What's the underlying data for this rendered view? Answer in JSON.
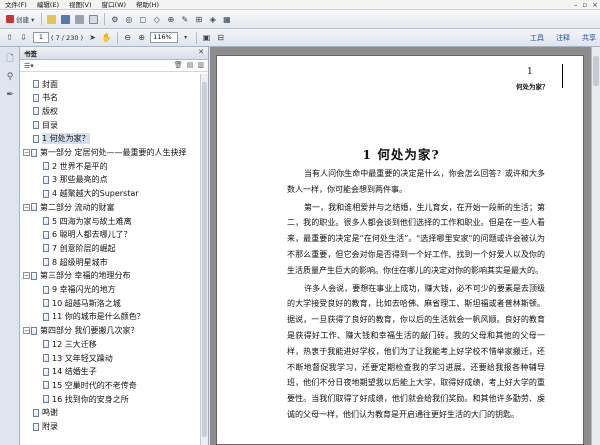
{
  "menu": {
    "items": [
      "文件(F)",
      "编辑(E)",
      "视图(V)",
      "窗口(W)",
      "帮助(H)"
    ]
  },
  "toolbar": {
    "create_label": "创建 ▾",
    "page_current": "1",
    "page_count": "( 7 / 230 )",
    "zoom_value": "116%",
    "links": [
      "工具",
      "注释",
      "共享"
    ]
  },
  "panel": {
    "title": "书签",
    "close": "✕"
  },
  "bookmarks": [
    {
      "label": "封面",
      "level": 0
    },
    {
      "label": "书名",
      "level": 0
    },
    {
      "label": "版权",
      "level": 0
    },
    {
      "label": "目录",
      "level": 0
    },
    {
      "label": "1  何处为家？",
      "level": 0,
      "selected": true
    },
    {
      "label": "第一部分  定居何处——最重要的人生抉择",
      "level": 0,
      "toggle": "−"
    },
    {
      "label": "2  世界不是平的",
      "level": 1
    },
    {
      "label": "3  那些最亮的点",
      "level": 1
    },
    {
      "label": "4  越聚越大的Superstar",
      "level": 1
    },
    {
      "label": "第二部分  流动的财富",
      "level": 0,
      "toggle": "−"
    },
    {
      "label": "5  四海为家与故土难离",
      "level": 1
    },
    {
      "label": "6  聪明人都去哪儿了？",
      "level": 1
    },
    {
      "label": "7  创意阶层的崛起",
      "level": 1
    },
    {
      "label": "8  超级明星城市",
      "level": 1
    },
    {
      "label": "第三部分  幸福的地理分布",
      "level": 0,
      "toggle": "−"
    },
    {
      "label": "9  幸福闪光的地方",
      "level": 1
    },
    {
      "label": "10  超越马斯洛之城",
      "level": 1
    },
    {
      "label": "11  你的城市是什么颜色？",
      "level": 1
    },
    {
      "label": "第四部分  我们要搬几次家？",
      "level": 0,
      "toggle": "−"
    },
    {
      "label": "12  三大迁移",
      "level": 1
    },
    {
      "label": "13  又年轻又躁动",
      "level": 1
    },
    {
      "label": "14  结婚生子",
      "level": 1
    },
    {
      "label": "15  空巢时代的不老传奇",
      "level": 1
    },
    {
      "label": "16  找到你的安身之所",
      "level": 1
    },
    {
      "label": "鸣谢",
      "level": 0
    },
    {
      "label": "附录",
      "level": 0
    }
  ],
  "document": {
    "header_number": "1",
    "header_title": "何处为家？",
    "chapter_title": "1   何处为家?",
    "paragraphs": [
      "当有人问你生命中最重要的决定是什么，你会怎么回答？或许和大多数人一样，你可能会想到两件事。",
      "第一，我和谁相爱并与之结婚，生儿育女，在开始一段新的生活；第二，我的职业。很多人都会谈到他们选择的工作和职业。但是在一些人看来，最重要的决定是“在何处生活”。\"选择哪里安家\"的问题或许会被认为不那么重要，但它会对你是否得到一个好工作、找到一个好爱人以及你的生活质量产生巨大的影响。你住在哪儿的决定对你的影响其实是最大的。",
      "许多人会说，要想在事业上成功，赚大钱，必不可少的要素是去顶级的大学接受良好的教育，比如去哈佛、麻省理工、斯坦福或者普林斯顿。据说，一旦获得了良好的教育，你以后的生活就会一帆风顺。良好的教育是获得好工作、赚大钱和幸福生活的敲门砖。我的父母和其他的父母一样，热衷于我能进好学校，他们为了让我能考上好学校不惜举家搬迁，还不断地督促我学习，还要定期检查我的学习进展，还要给我报各种辅导班，他们不分日夜地期望我以后能上大学，取得好成绩，考上好大学的重要性。当我们取得了好成绩，他们就会给我们奖励。和其他许多勤劳、虔诚的父母一样，他们认为教育是开启通往更好生活的大门的钥匙。"
    ]
  },
  "colors": {
    "doc_bg": "#8d8d8d",
    "panel_bg": "#ffffff",
    "selected_bg": "#d4dff0",
    "link": "#1a4f9c"
  }
}
